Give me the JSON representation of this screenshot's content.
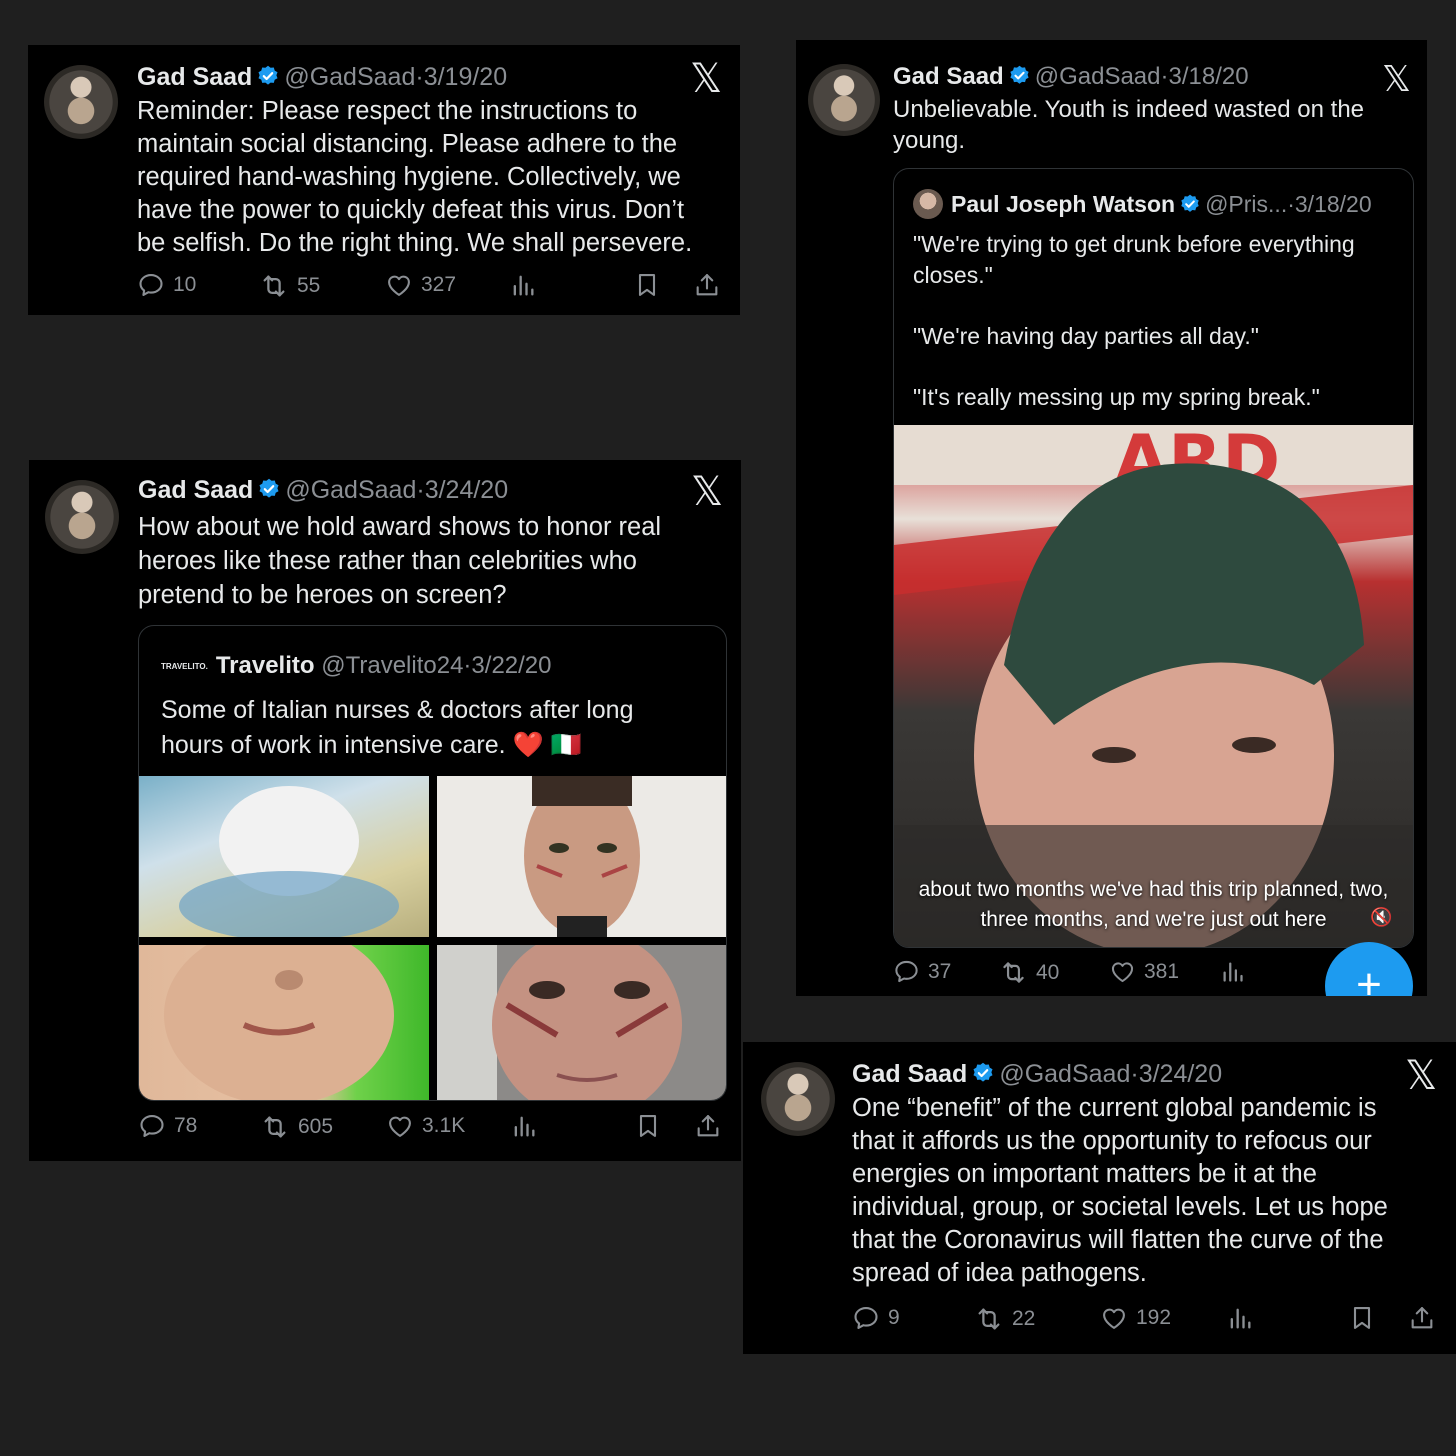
{
  "brand": {
    "accent": "#1d9bf0",
    "x_logo": "𝕏"
  },
  "tweet1": {
    "name": "Gad Saad",
    "handle": "@GadSaad",
    "sep": "·",
    "date": "3/19/20",
    "text": "Reminder: Please respect the instructions to\nmaintain social distancing. Please adhere to the\nrequired hand-washing hygiene.  Collectively, we\nhave the power to quickly defeat this virus. Don’t\nbe selfish. Do the right thing. We shall persevere.",
    "replies": "10",
    "retweets": "55",
    "likes": "327"
  },
  "tweet2": {
    "name": "Gad Saad",
    "handle": "@GadSaad",
    "sep": "·",
    "date": "3/24/20",
    "text": "How about we hold award shows to honor real\nheroes like these rather than celebrities who\npretend to be heroes on screen?",
    "quote": {
      "logo_text": "TRAVELITO.",
      "name": "Travelito",
      "handle": "@Travelito24",
      "sep": "·",
      "date": "3/22/20",
      "text": "Some of Italian nurses & doctors after long\nhours of work in intensive care. ❤️ 🇮🇹"
    },
    "replies": "78",
    "retweets": "605",
    "likes": "3.1K"
  },
  "tweet3": {
    "name": "Gad Saad",
    "handle": "@GadSaad",
    "sep": "·",
    "date": "3/18/20",
    "text": "Unbelievable. Youth is indeed wasted on the\nyoung.",
    "quote": {
      "name": "Paul Joseph Watson",
      "handle": "@Pris...",
      "sep": "·",
      "date": "3/18/20",
      "text": "\"We're trying to get drunk before everything\ncloses.\"\n\n\"We're having day parties all day.\"\n\n\"It's really messing up my spring break.\"",
      "video_caption": "about two months we've had this trip planned,\ntwo, three months, and we're just out here"
    },
    "replies": "37",
    "retweets": "40",
    "likes": "381",
    "fab_label": "+"
  },
  "tweet4": {
    "name": "Gad Saad",
    "handle": "@GadSaad",
    "sep": "·",
    "date": "3/24/20",
    "text": "One “benefit” of the current global pandemic is\nthat it affords us the opportunity to refocus our\nenergies on important matters be it at the\nindividual, group, or societal levels.  Let us hope\nthat the Coronavirus will flatten the curve of the\nspread of idea pathogens.",
    "replies": "9",
    "retweets": "22",
    "likes": "192"
  }
}
